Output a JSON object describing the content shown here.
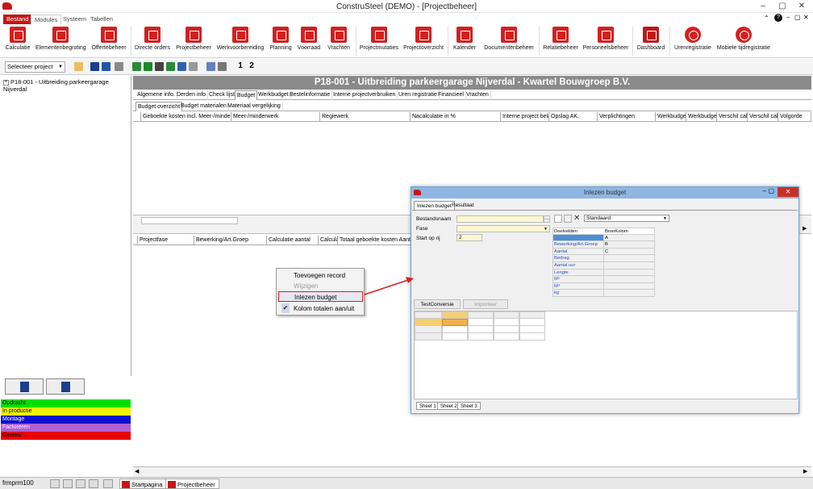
{
  "window": {
    "title": "ConstruSteel (DEMO) - [Projectbeheer]"
  },
  "menu": {
    "tabs": [
      "Bestand",
      "Modules",
      "Systeem",
      "Tabellen"
    ]
  },
  "ribbon": {
    "items": [
      "Calculatie",
      "Elementenbegroting",
      "Offertebeheer",
      "Directe orders",
      "Projectbeheer",
      "Werkvoorbereiding",
      "Planning",
      "Voorraad",
      "Vrachten",
      "Projectmutaties",
      "Projectoverzicht",
      "Kalender",
      "Documentenbeheer",
      "Relatiebeheer",
      "Personeelsbeheer",
      "Dashboard",
      "Urenregistratie",
      "Mobiele tijdregistratie"
    ]
  },
  "toolbar": {
    "project_select": "Selecteer project",
    "btn1": "1",
    "btn2": "2"
  },
  "tree": {
    "node": "P18-001 - Uitbreiding parkeergarage Nijverdal"
  },
  "statuses": [
    {
      "label": "Opdracht",
      "color": "#00e000"
    },
    {
      "label": "In productie",
      "color": "#f4f400"
    },
    {
      "label": "Montage",
      "color": "#1010d0"
    },
    {
      "label": "Factureren",
      "color": "#b060d0"
    },
    {
      "label": "Gereed",
      "color": "#e80000"
    }
  ],
  "main": {
    "header": "P18-001 - Uitbreiding parkeergarage Nijverdal - Kwartel Bouwgroep B.V.",
    "tabs": [
      "Algemene info.",
      "Derden info",
      "Check lijst",
      "Budget",
      "Werkbudget",
      "Bestelinformatie",
      "Interne projectverbruiken",
      "Uren registratie",
      "Financieel",
      "Vrachten"
    ],
    "subtabs": [
      "Budget overzicht",
      "Budget materialen",
      "Materiaal vergelijking"
    ],
    "grid1_columns": [
      "Geboekte kosten incl. Meer-/minderwerk",
      "Meer-/minderwerk",
      "Regiewerk",
      "Nacalculatie in %",
      "Interne project bela",
      "Opslag AK.",
      "Verplichtingen",
      "Werkbudget",
      "Werkbudget",
      "Verschil calc",
      "Verschil calc",
      "Volgorde"
    ],
    "grid2_columns": [
      "Projectfase",
      "Bewerking/Art.Groep",
      "Calculatie aantal",
      "Calculat",
      "Totaal geboekte kosten Aanta"
    ]
  },
  "context_menu": {
    "items": [
      "Toevoegen record",
      "Wijzigen",
      "Inlezen budget",
      "Kolom totalen aan/uit"
    ]
  },
  "dialog": {
    "title": "Inlezen budget",
    "tabs": [
      "Inlezen budget",
      "Resultaat"
    ],
    "labels": {
      "bestandsnaam": "Bestandsnaam",
      "fase": "Fase",
      "start_op_rij": "Start op rij"
    },
    "start_op_rij_value": "2",
    "template": "Standaard",
    "mapping_header": [
      "Doelvelden",
      "BronKolom"
    ],
    "mapping": [
      {
        "field": "",
        "col": "A"
      },
      {
        "field": "Bewerking/Art.Groep",
        "col": "B"
      },
      {
        "field": "Aantal",
        "col": "C"
      },
      {
        "field": "Bedrag",
        "col": ""
      },
      {
        "field": "Aantal uur",
        "col": ""
      },
      {
        "field": "Lengte",
        "col": ""
      },
      {
        "field": "M²",
        "col": ""
      },
      {
        "field": "M³",
        "col": ""
      },
      {
        "field": "kg",
        "col": ""
      }
    ],
    "buttons": {
      "test": "TestConversie",
      "import": "Importeer"
    },
    "sheets": [
      "Sheet 1",
      "Sheet 2",
      "Sheet 3"
    ]
  },
  "statusbar": {
    "form": "frmprm100",
    "tabs": [
      "Startpagina",
      "Projectbeheer"
    ]
  }
}
